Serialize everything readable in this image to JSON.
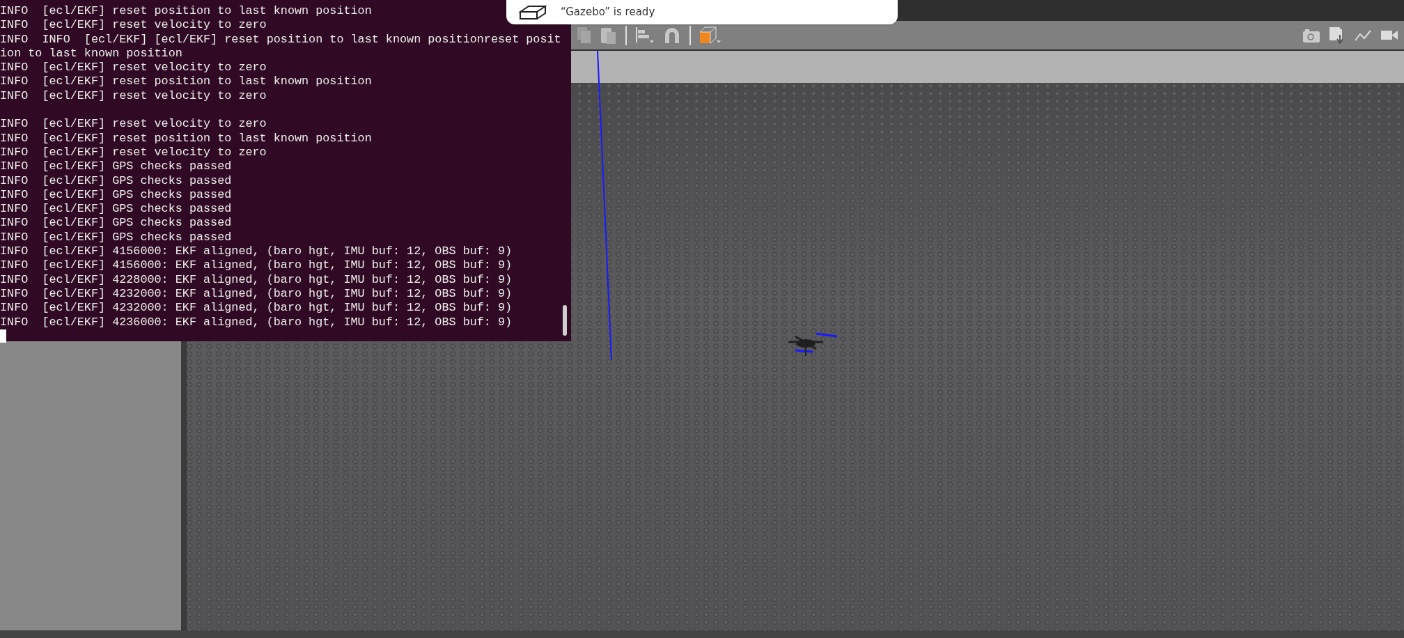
{
  "notification": {
    "text": "“Gazebo” is ready"
  },
  "terminal": {
    "cursor_visible": true,
    "lines": [
      {
        "kind": "text",
        "text": "INFO  [ecl/EKF] reset position to last known position"
      },
      {
        "kind": "text",
        "text": "INFO  [ecl/EKF] reset velocity to zero"
      },
      {
        "kind": "text",
        "text": "INFO  INFO  [ecl/EKF] [ecl/EKF] reset position to last known positionreset position to last known position"
      },
      {
        "kind": "text",
        "text": "INFO  [ecl/EKF] reset velocity to zero"
      },
      {
        "kind": "text",
        "text": "INFO  [ecl/EKF] reset position to last known position"
      },
      {
        "kind": "text",
        "text": "INFO  [ecl/EKF] reset velocity to zero"
      },
      {
        "kind": "blank"
      },
      {
        "kind": "text",
        "text": "INFO  [ecl/EKF] reset velocity to zero"
      },
      {
        "kind": "text",
        "text": "INFO  [ecl/EKF] reset position to last known position"
      },
      {
        "kind": "text",
        "text": "INFO  [ecl/EKF] reset velocity to zero"
      },
      {
        "kind": "text",
        "text": "INFO  [ecl/EKF] GPS checks passed"
      },
      {
        "kind": "text",
        "text": "INFO  [ecl/EKF] GPS checks passed"
      },
      {
        "kind": "text",
        "text": "INFO  [ecl/EKF] GPS checks passed"
      },
      {
        "kind": "text",
        "text": "INFO  [ecl/EKF] GPS checks passed"
      },
      {
        "kind": "text",
        "text": "INFO  [ecl/EKF] GPS checks passed"
      },
      {
        "kind": "text",
        "text": "INFO  [ecl/EKF] GPS checks passed"
      },
      {
        "kind": "text",
        "text": "INFO  [ecl/EKF] 4156000: EKF aligned, (baro hgt, IMU buf: 12, OBS buf: 9)"
      },
      {
        "kind": "text",
        "text": "INFO  [ecl/EKF] 4156000: EKF aligned, (baro hgt, IMU buf: 12, OBS buf: 9)"
      },
      {
        "kind": "text",
        "text": "INFO  [ecl/EKF] 4228000: EKF aligned, (baro hgt, IMU buf: 12, OBS buf: 9)"
      },
      {
        "kind": "text",
        "text": "INFO  [ecl/EKF] 4232000: EKF aligned, (baro hgt, IMU buf: 12, OBS buf: 9)"
      },
      {
        "kind": "text",
        "text": "INFO  [ecl/EKF] 4232000: EKF aligned, (baro hgt, IMU buf: 12, OBS buf: 9)"
      },
      {
        "kind": "text",
        "text": "INFO  [ecl/EKF] 4236000: EKF aligned, (baro hgt, IMU buf: 12, OBS buf: 9)"
      }
    ]
  }
}
